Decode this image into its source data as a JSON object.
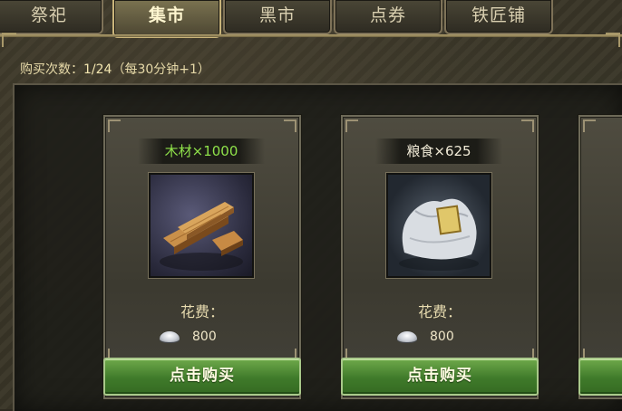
{
  "tabs": [
    {
      "label": "祭祀"
    },
    {
      "label": "集市"
    },
    {
      "label": "黑市"
    },
    {
      "label": "点券"
    },
    {
      "label": "铁匠铺"
    }
  ],
  "active_tab": "集市",
  "purchase": {
    "label": "购买次数：",
    "count": "1/24",
    "note": "（每30分钟+1）"
  },
  "items": [
    {
      "name": "木材×1000",
      "name_color": "green",
      "icon": "wood-planks-icon",
      "cost_label": "花费：",
      "price": "800",
      "buy_label": "点击购买"
    },
    {
      "name": "粮食×625",
      "name_color": "white",
      "icon": "grain-sack-icon",
      "cost_label": "花费：",
      "price": "800",
      "buy_label": "点击购买"
    }
  ],
  "colors": {
    "item_name_green": "#8fe24a",
    "buy_button": "#4e8c34",
    "tab_active_text": "#fff6d0"
  }
}
